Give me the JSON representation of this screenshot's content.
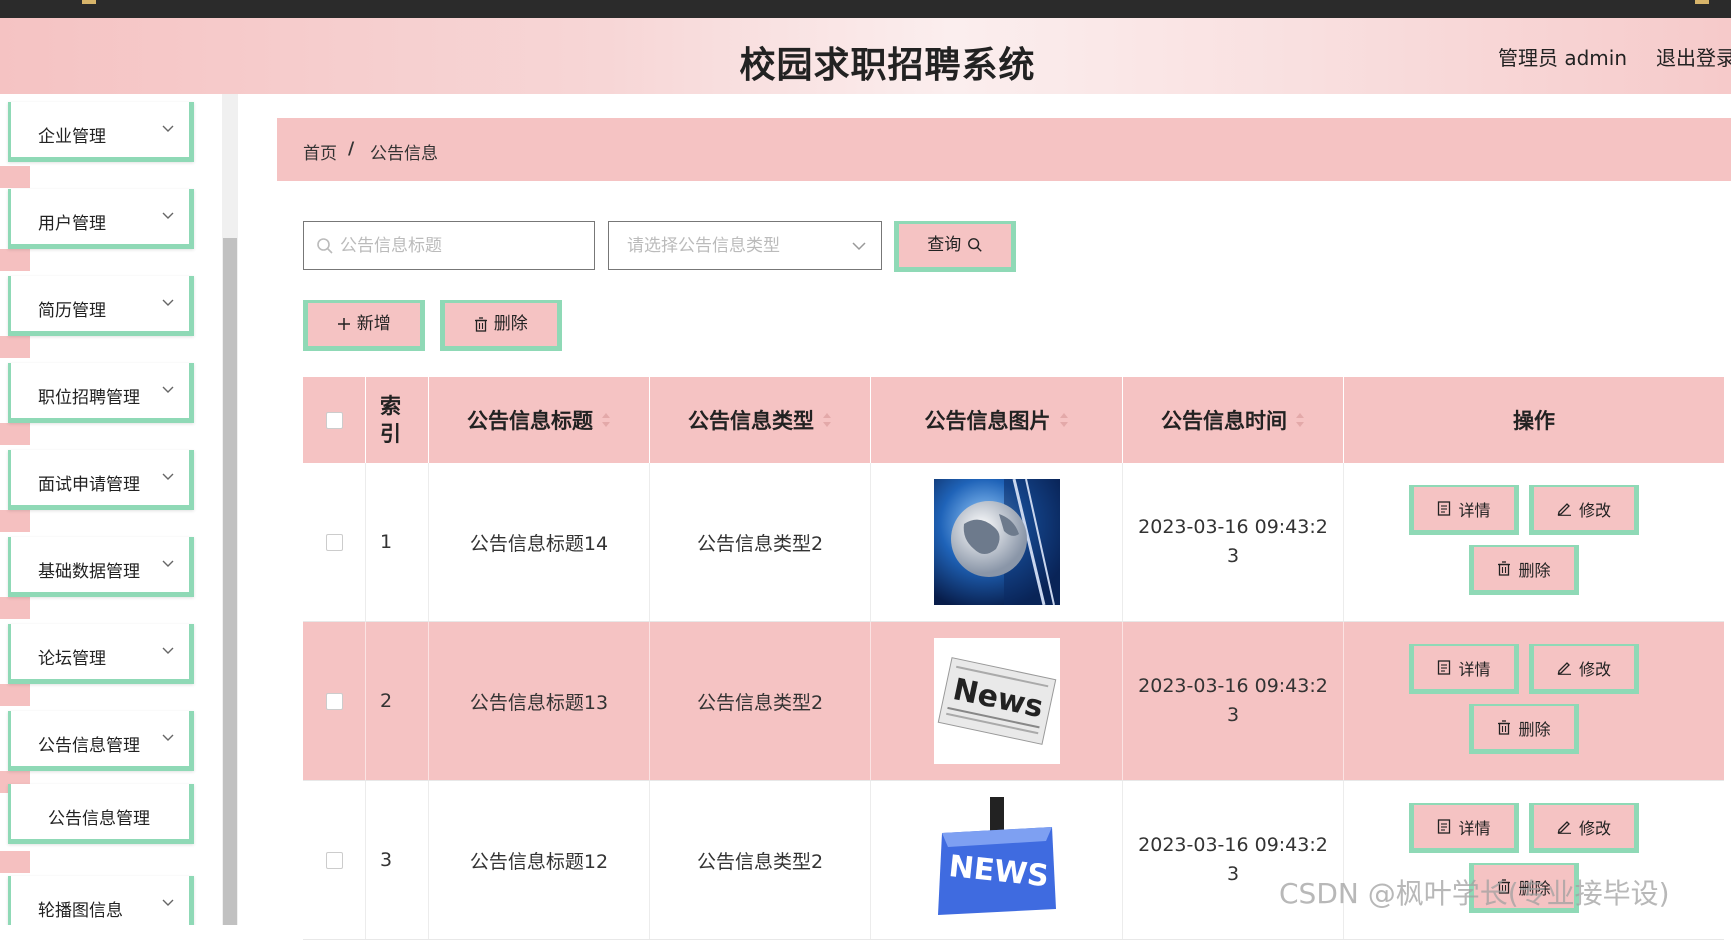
{
  "header": {
    "title": "校园求职招聘系统",
    "user": "管理员 admin",
    "logout": "退出登录"
  },
  "sidebar": {
    "items": [
      {
        "label": "企业管理"
      },
      {
        "label": "用户管理"
      },
      {
        "label": "简历管理"
      },
      {
        "label": "职位招聘管理"
      },
      {
        "label": "面试申请管理"
      },
      {
        "label": "基础数据管理"
      },
      {
        "label": "论坛管理"
      },
      {
        "label": "公告信息管理"
      },
      {
        "label": "公告信息管理",
        "sub": true
      },
      {
        "label": "轮播图信息"
      }
    ]
  },
  "breadcrumb": {
    "home": "首页",
    "separator": "/",
    "current": "公告信息"
  },
  "search": {
    "title_placeholder": "公告信息标题",
    "type_placeholder": "请选择公告信息类型",
    "query_label": "查询"
  },
  "toolbar": {
    "add_label": "新增",
    "delete_label": "删除"
  },
  "table": {
    "headers": {
      "index": "索引",
      "title": "公告信息标题",
      "type": "公告信息类型",
      "image": "公告信息图片",
      "time": "公告信息时间",
      "actions": "操作"
    },
    "rows": [
      {
        "index": "1",
        "title": "公告信息标题14",
        "type": "公告信息类型2",
        "image": "globe-news-image",
        "time": "2023-03-16 09:43:23"
      },
      {
        "index": "2",
        "title": "公告信息标题13",
        "type": "公告信息类型2",
        "image": "newspaper-image",
        "time": "2023-03-16 09:43:23"
      },
      {
        "index": "3",
        "title": "公告信息标题12",
        "type": "公告信息类型2",
        "image": "news-key-image",
        "time": "2023-03-16 09:43:23"
      }
    ],
    "actions": {
      "detail": "详情",
      "edit": "修改",
      "delete": "删除"
    }
  },
  "watermark": "CSDN @枫叶学长(专业接毕设)",
  "colors": {
    "accent_pink": "#f5c3c3",
    "accent_green": "#8fd9b6"
  }
}
